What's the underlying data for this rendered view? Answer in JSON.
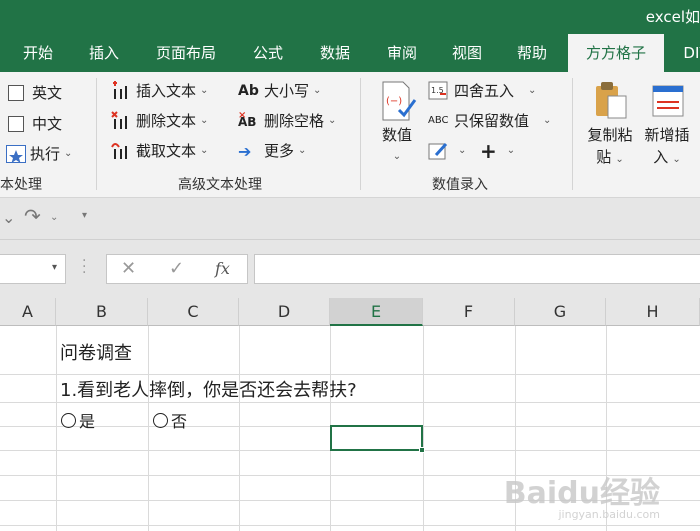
{
  "window": {
    "title": "excel如"
  },
  "tabs": [
    {
      "label": "开始"
    },
    {
      "label": "插入"
    },
    {
      "label": "页面布局"
    },
    {
      "label": "公式"
    },
    {
      "label": "数据"
    },
    {
      "label": "审阅"
    },
    {
      "label": "视图"
    },
    {
      "label": "帮助"
    },
    {
      "label": "方方格子"
    },
    {
      "label": "DIY"
    }
  ],
  "ribbon": {
    "group1": {
      "items": [
        "英文",
        "中文",
        "执行"
      ],
      "label": "本处理"
    },
    "group2": {
      "left": [
        "插入文本",
        "删除文本",
        "截取文本"
      ],
      "right": [
        "大小写",
        "删除空格",
        "更多"
      ],
      "label": "高级文本处理"
    },
    "group3": {
      "big": "数值",
      "items": [
        "四舍五入",
        "只保留数值"
      ],
      "plus": "+",
      "label": "数值录入"
    },
    "group4": {
      "copy_paste": [
        "复制粘",
        "贴"
      ],
      "new_insert": [
        "新增插",
        "入"
      ]
    }
  },
  "formula_bar": {
    "cancel": "✕",
    "enter": "✓",
    "fx": "fx",
    "value": ""
  },
  "columns": [
    "A",
    "B",
    "C",
    "D",
    "E",
    "F",
    "G",
    "H"
  ],
  "selected_column": "E",
  "sheet": {
    "title_cell": "问卷调查",
    "question": "1.看到老人摔倒，你是否还会去帮扶?",
    "options": [
      "是",
      "否"
    ]
  },
  "watermark": {
    "brand": "Baidu经验",
    "url": "jingyan.baidu.com"
  }
}
